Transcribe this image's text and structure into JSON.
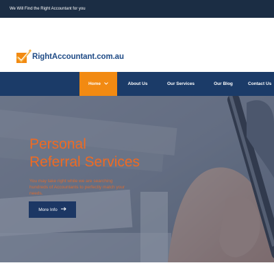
{
  "topbar": {
    "tagline": "We Will Find the Right Accountant for you"
  },
  "logo": {
    "text": "RightAccountant.com.au"
  },
  "nav": {
    "items": [
      {
        "label": "Home",
        "active": true,
        "has_dropdown": true
      },
      {
        "label": "About Us",
        "active": false
      },
      {
        "label": "Our Services",
        "active": false
      },
      {
        "label": "Our Blog",
        "active": false
      },
      {
        "label": "Contact Us",
        "active": false
      }
    ]
  },
  "hero": {
    "title_line1": "Personal",
    "title_line2": "Referral Services",
    "text": "You may take right while we are searching hundreds of Accountants to perfectly match your needs.",
    "button_label": "More Info",
    "button_icon": "arrow-right-icon"
  },
  "colors": {
    "topbar": "#1b2d44",
    "navbar": "#1b3b68",
    "accent": "#f28a12",
    "hero_text": "#ef6a22",
    "button": "#1c3764",
    "logo_text": "#1f4b86"
  }
}
